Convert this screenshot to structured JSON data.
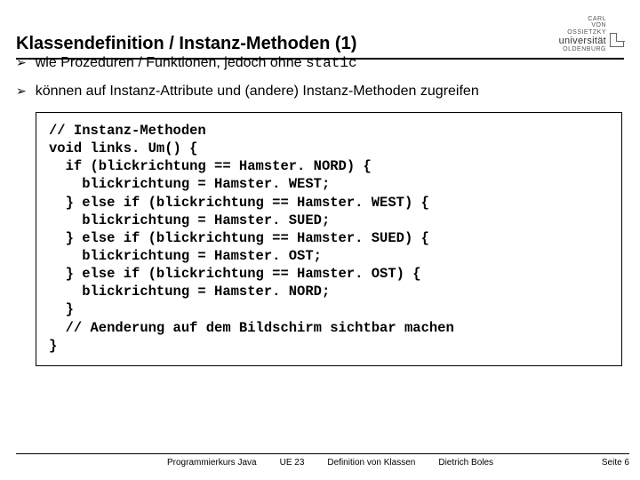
{
  "header": {
    "title": "Klassendefinition / Instanz-Methoden (1)",
    "logo": {
      "line1": "CARL",
      "line2": "VON",
      "line3": "OSSIETZKY",
      "university": "universität",
      "city": "OLDENBURG"
    }
  },
  "bullets": [
    {
      "prefix": "wie Prozeduren / Funktionen, jedoch ohne ",
      "code": "static"
    },
    {
      "prefix": "können auf Instanz-Attribute und (andere) Instanz-Methoden zugreifen",
      "code": ""
    }
  ],
  "code": "// Instanz-Methoden\nvoid links. Um() {\n  if (blickrichtung == Hamster. NORD) {\n    blickrichtung = Hamster. WEST;\n  } else if (blickrichtung == Hamster. WEST) {\n    blickrichtung = Hamster. SUED;\n  } else if (blickrichtung == Hamster. SUED) {\n    blickrichtung = Hamster. OST;\n  } else if (blickrichtung == Hamster. OST) {\n    blickrichtung = Hamster. NORD;\n  }\n  // Aenderung auf dem Bildschirm sichtbar machen\n}",
  "footer": {
    "course": "Programmierkurs Java",
    "unit": "UE 23",
    "topic": "Definition von Klassen",
    "author": "Dietrich Boles",
    "page": "Seite 6"
  }
}
